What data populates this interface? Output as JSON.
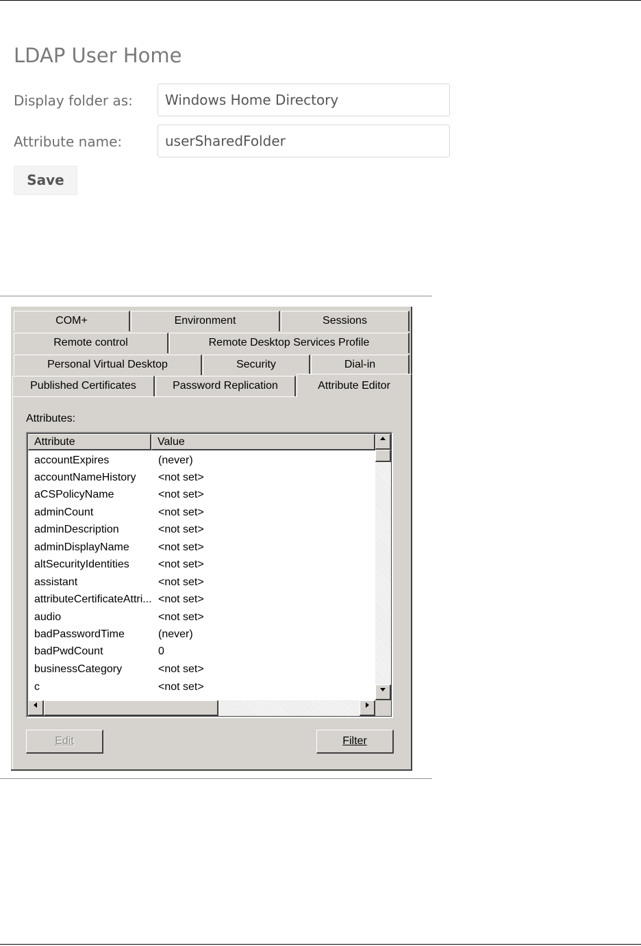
{
  "ldap_form": {
    "title": "LDAP User Home",
    "display_folder_label": "Display folder as:",
    "display_folder_value": "Windows Home Directory",
    "attribute_name_label": "Attribute name:",
    "attribute_name_value": "userSharedFolder",
    "save_label": "Save"
  },
  "dialog": {
    "tabs_row1": [
      "COM+",
      "Environment",
      "Sessions"
    ],
    "tabs_row2": [
      "Remote control",
      "Remote Desktop Services Profile"
    ],
    "tabs_row3": [
      "Personal Virtual Desktop",
      "Security",
      "Dial-in"
    ],
    "tabs_row4": [
      "Published Certificates",
      "Password Replication",
      "Attribute Editor"
    ],
    "active_tab": "Attribute Editor",
    "attributes_label": "Attributes:",
    "columns": [
      "Attribute",
      "Value"
    ],
    "rows": [
      {
        "attribute": "accountExpires",
        "value": "(never)"
      },
      {
        "attribute": "accountNameHistory",
        "value": "<not set>"
      },
      {
        "attribute": "aCSPolicyName",
        "value": "<not set>"
      },
      {
        "attribute": "adminCount",
        "value": "<not set>"
      },
      {
        "attribute": "adminDescription",
        "value": "<not set>"
      },
      {
        "attribute": "adminDisplayName",
        "value": "<not set>"
      },
      {
        "attribute": "altSecurityIdentities",
        "value": "<not set>"
      },
      {
        "attribute": "assistant",
        "value": "<not set>"
      },
      {
        "attribute": "attributeCertificateAttri...",
        "value": "<not set>"
      },
      {
        "attribute": "audio",
        "value": "<not set>"
      },
      {
        "attribute": "badPasswordTime",
        "value": "(never)"
      },
      {
        "attribute": "badPwdCount",
        "value": "0"
      },
      {
        "attribute": "businessCategory",
        "value": "<not set>"
      },
      {
        "attribute": "c",
        "value": "<not set>"
      }
    ],
    "edit_label": "Edit",
    "filter_label": "Filter"
  }
}
